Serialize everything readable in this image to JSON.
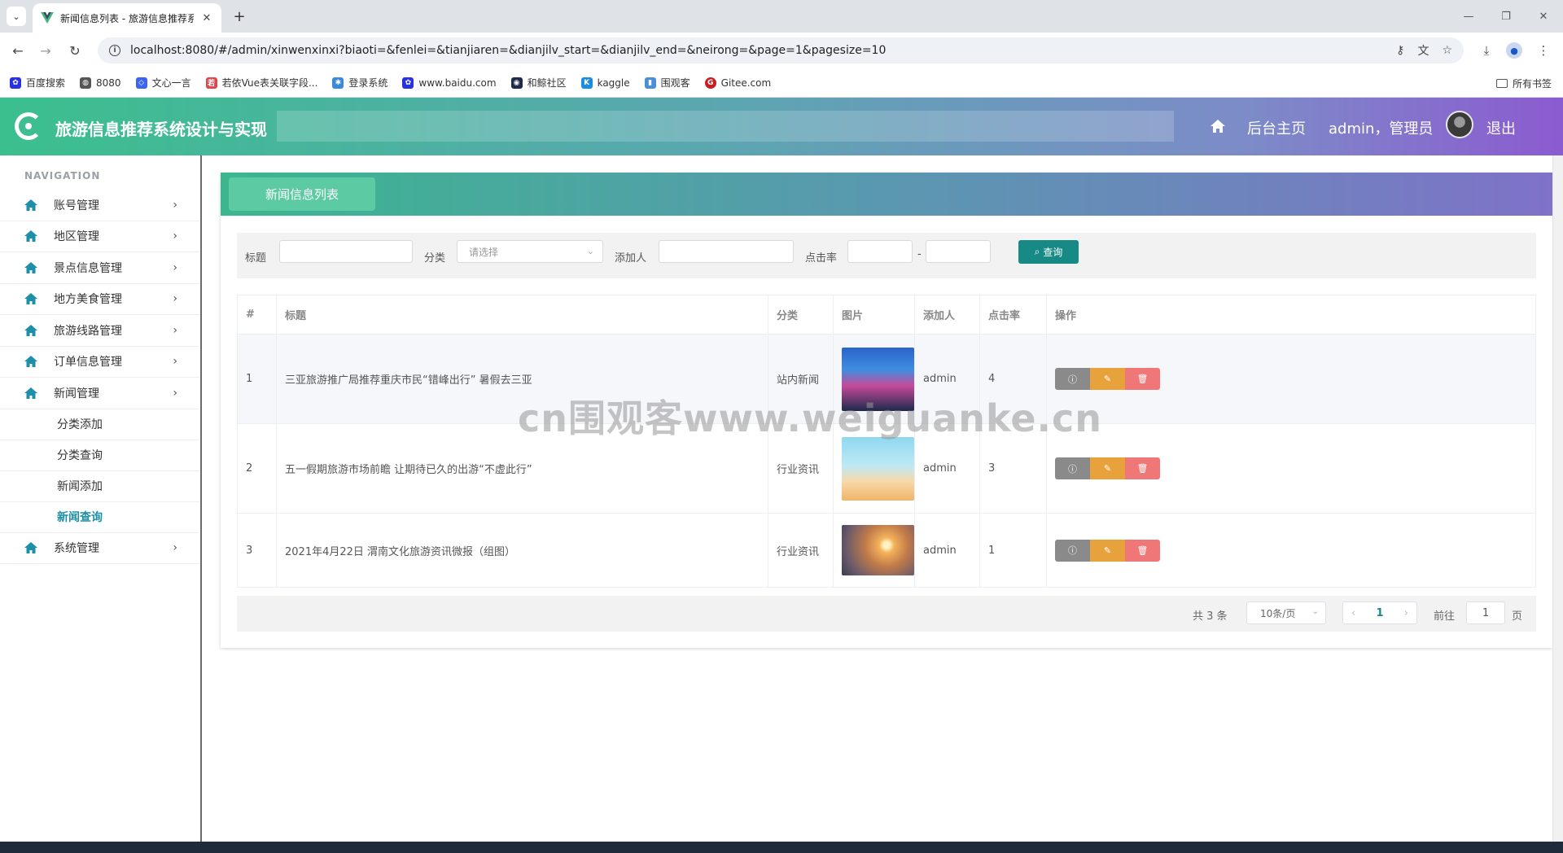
{
  "browser": {
    "tab_title": "新闻信息列表 - 旅游信息推荐系...",
    "url": "localhost:8080/#/admin/xinwenxinxi?biaoti=&fenlei=&tianjiaren=&dianjilv_start=&dianjilv_end=&neirong=&page=1&pagesize=10",
    "bookmarks": [
      {
        "label": "百度搜索",
        "icon": "paw-icon",
        "color": "#2932e1"
      },
      {
        "label": "8080",
        "icon": "globe-icon",
        "color": "#555555"
      },
      {
        "label": "文心一言",
        "icon": "wenxin-icon",
        "color": "#3b63f5"
      },
      {
        "label": "若依Vue表关联字段...",
        "icon": "ruoyi-icon",
        "color": "#e0454a"
      },
      {
        "label": "登录系统",
        "icon": "login-icon",
        "color": "#3a8ad9"
      },
      {
        "label": "www.baidu.com",
        "icon": "paw-icon",
        "color": "#2932e1"
      },
      {
        "label": "和鲸社区",
        "icon": "whale-icon",
        "color": "#1e2a4a"
      },
      {
        "label": "kaggle",
        "icon": "kaggle-icon",
        "color": "#1c8ce0"
      },
      {
        "label": "围观客",
        "icon": "weiguanke-icon",
        "color": "#4a8fd8"
      },
      {
        "label": "Gitee.com",
        "icon": "gitee-icon",
        "color": "#c71d23"
      }
    ],
    "bookmarks_folder": "所有书签"
  },
  "header": {
    "title": "旅游信息推荐系统设计与实现",
    "home_link": "后台主页",
    "user": "admin，管理员",
    "logout": "退出"
  },
  "sidebar": {
    "caption": "NAVIGATION",
    "items": [
      {
        "label": "账号管理"
      },
      {
        "label": "地区管理"
      },
      {
        "label": "景点信息管理"
      },
      {
        "label": "地方美食管理"
      },
      {
        "label": "旅游线路管理"
      },
      {
        "label": "订单信息管理"
      },
      {
        "label": "新闻管理"
      },
      {
        "label": "系统管理"
      }
    ],
    "news_sub": [
      {
        "label": "分类添加"
      },
      {
        "label": "分类查询"
      },
      {
        "label": "新闻添加"
      },
      {
        "label": "新闻查询"
      }
    ]
  },
  "panel": {
    "tab": "新闻信息列表"
  },
  "search": {
    "title_label": "标题",
    "category_label": "分类",
    "category_placeholder": "请选择",
    "adder_label": "添加人",
    "click_label": "点击率",
    "dash": "-",
    "button": "查询"
  },
  "table": {
    "columns": [
      "#",
      "标题",
      "分类",
      "图片",
      "添加人",
      "点击率",
      "操作"
    ],
    "rows": [
      {
        "num": "1",
        "title": "三亚旅游推广局推荐重庆市民“错峰出行” 暑假去三亚",
        "category": "站内新闻",
        "user": "admin",
        "clicks": "4"
      },
      {
        "num": "2",
        "title": "五一假期旅游市场前瞻 让期待已久的出游“不虚此行”",
        "category": "行业资讯",
        "user": "admin",
        "clicks": "3"
      },
      {
        "num": "3",
        "title": "2021年4月22日 渭南文化旅游资讯微报（组图）",
        "category": "行业资讯",
        "user": "admin",
        "clicks": "1"
      }
    ]
  },
  "pager": {
    "total": "共 3 条",
    "size": "10条/页",
    "current": "1",
    "goto": "前往",
    "goto_value": "1",
    "page_suffix": "页"
  },
  "watermark": "cn围观客www.weiguanke.cn",
  "colors": {
    "header_gradient_start": "#3bbf8e",
    "header_gradient_end": "#8b5bd0",
    "accent": "#178a86",
    "active_menu": "#1e8fa8"
  }
}
